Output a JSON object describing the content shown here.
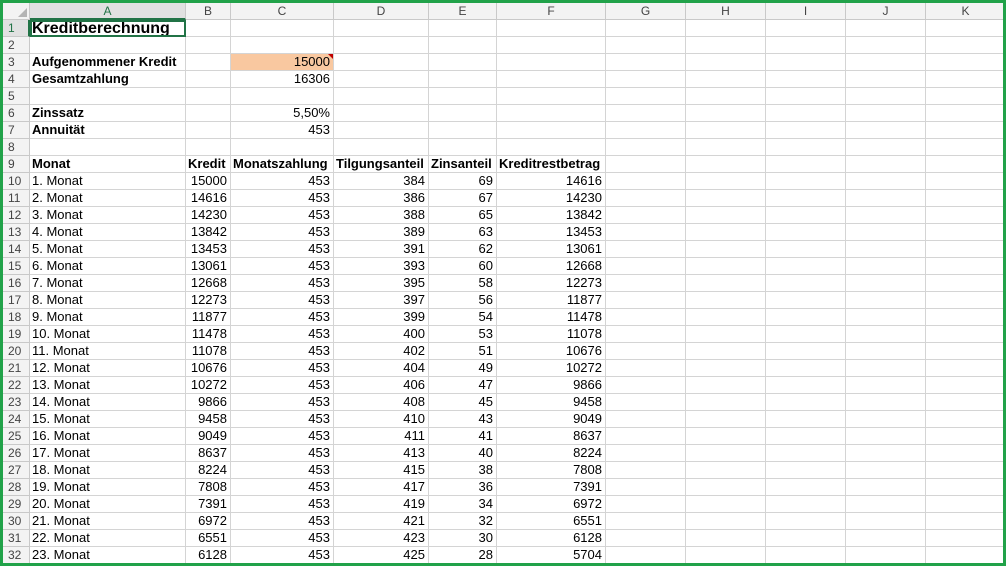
{
  "columns": [
    "A",
    "B",
    "C",
    "D",
    "E",
    "F",
    "G",
    "H",
    "I",
    "J",
    "K"
  ],
  "selected_column": "A",
  "selected_row": 1,
  "colors": {
    "accent": "#217346",
    "frame": "#21a249",
    "input_fill": "#f9c8a0"
  },
  "cells": {
    "title": "Kreditberechnung",
    "label_kredit": "Aufgenommener Kredit",
    "value_kredit": "15000",
    "label_gesamt": "Gesamtzahlung",
    "value_gesamt": "16306",
    "label_zinssatz": "Zinssatz",
    "value_zinssatz": "5,50%",
    "label_annuitaet": "Annuität",
    "value_annuitaet": "453"
  },
  "table": {
    "headers": [
      "Monat",
      "Kredit",
      "Monatszahlung",
      "Tilgungsanteil",
      "Zinsanteil",
      "Kreditrestbetrag"
    ],
    "rows": [
      [
        "1. Monat",
        "15000",
        "453",
        "384",
        "69",
        "14616"
      ],
      [
        "2. Monat",
        "14616",
        "453",
        "386",
        "67",
        "14230"
      ],
      [
        "3. Monat",
        "14230",
        "453",
        "388",
        "65",
        "13842"
      ],
      [
        "4. Monat",
        "13842",
        "453",
        "389",
        "63",
        "13453"
      ],
      [
        "5. Monat",
        "13453",
        "453",
        "391",
        "62",
        "13061"
      ],
      [
        "6. Monat",
        "13061",
        "453",
        "393",
        "60",
        "12668"
      ],
      [
        "7. Monat",
        "12668",
        "453",
        "395",
        "58",
        "12273"
      ],
      [
        "8. Monat",
        "12273",
        "453",
        "397",
        "56",
        "11877"
      ],
      [
        "9. Monat",
        "11877",
        "453",
        "399",
        "54",
        "11478"
      ],
      [
        "10. Monat",
        "11478",
        "453",
        "400",
        "53",
        "11078"
      ],
      [
        "11. Monat",
        "11078",
        "453",
        "402",
        "51",
        "10676"
      ],
      [
        "12. Monat",
        "10676",
        "453",
        "404",
        "49",
        "10272"
      ],
      [
        "13. Monat",
        "10272",
        "453",
        "406",
        "47",
        "9866"
      ],
      [
        "14. Monat",
        "9866",
        "453",
        "408",
        "45",
        "9458"
      ],
      [
        "15. Monat",
        "9458",
        "453",
        "410",
        "43",
        "9049"
      ],
      [
        "16. Monat",
        "9049",
        "453",
        "411",
        "41",
        "8637"
      ],
      [
        "17. Monat",
        "8637",
        "453",
        "413",
        "40",
        "8224"
      ],
      [
        "18. Monat",
        "8224",
        "453",
        "415",
        "38",
        "7808"
      ],
      [
        "19. Monat",
        "7808",
        "453",
        "417",
        "36",
        "7391"
      ],
      [
        "20. Monat",
        "7391",
        "453",
        "419",
        "34",
        "6972"
      ],
      [
        "21. Monat",
        "6972",
        "453",
        "421",
        "32",
        "6551"
      ],
      [
        "22. Monat",
        "6551",
        "453",
        "423",
        "30",
        "6128"
      ],
      [
        "23. Monat",
        "6128",
        "453",
        "425",
        "28",
        "5704"
      ]
    ]
  }
}
